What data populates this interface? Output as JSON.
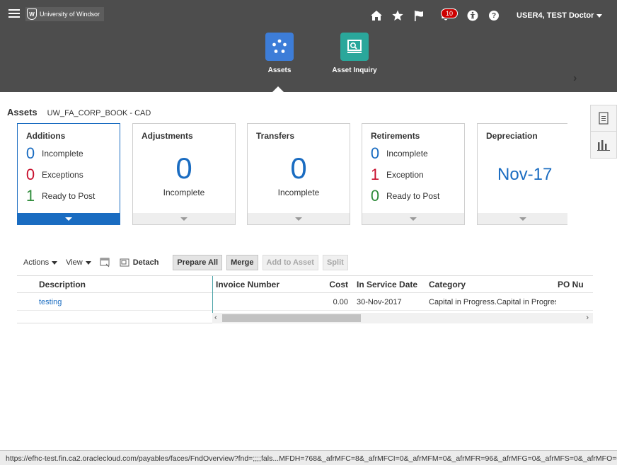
{
  "header": {
    "logo_text": "University of Windsor",
    "notification_count": "10",
    "user_name": "USER4, TEST Doctor"
  },
  "icons": {
    "menu": "hamburger-icon",
    "home": "home-icon",
    "favorites": "star-icon",
    "watchlist": "flag-icon",
    "notifications": "bell-icon",
    "accessibility": "accessibility-icon",
    "help": "help-icon"
  },
  "apps": [
    {
      "label": "Assets",
      "color": "#3d7dd8",
      "icon": "assets-icon"
    },
    {
      "label": "Asset Inquiry",
      "color": "#2aa79b",
      "icon": "asset-inquiry-icon"
    }
  ],
  "page": {
    "title": "Assets",
    "book": "UW_FA_CORP_BOOK - CAD"
  },
  "cards": {
    "additions": {
      "title": "Additions",
      "rows": [
        {
          "value": "0",
          "label": "Incomplete",
          "color": "#1a6cc1"
        },
        {
          "value": "0",
          "label": "Exceptions",
          "color": "#c8102e"
        },
        {
          "value": "1",
          "label": "Ready to Post",
          "color": "#2e8b3a"
        }
      ]
    },
    "adjustments": {
      "title": "Adjustments",
      "value": "0",
      "label": "Incomplete"
    },
    "transfers": {
      "title": "Transfers",
      "value": "0",
      "label": "Incomplete"
    },
    "retirements": {
      "title": "Retirements",
      "rows": [
        {
          "value": "0",
          "label": "Incomplete",
          "color": "#1a6cc1"
        },
        {
          "value": "1",
          "label": "Exception",
          "color": "#c8102e"
        },
        {
          "value": "0",
          "label": "Ready to Post",
          "color": "#2e8b3a"
        }
      ]
    },
    "depreciation": {
      "title": "Depreciation",
      "value": "Nov-17"
    }
  },
  "toolbar": {
    "actions": "Actions",
    "view": "View",
    "detach": "Detach",
    "prepare_all": "Prepare All",
    "merge": "Merge",
    "add_to_asset": "Add to Asset",
    "split": "Split"
  },
  "table": {
    "headers": {
      "description": "Description",
      "invoice_number": "Invoice Number",
      "cost": "Cost",
      "in_service_date": "In Service Date",
      "category": "Category",
      "po_number": "PO Nu"
    },
    "rows": [
      {
        "description": "testing",
        "invoice_number": "",
        "cost": "0.00",
        "in_service_date": "30-Nov-2017",
        "category": "Capital in Progress.Capital in Progres",
        "po_number": ""
      }
    ]
  },
  "status_bar": {
    "url": "https://efhc-test.fin.ca2.oraclecloud.com/payables/faces/FndOverview?fnd=;;;;fals...MFDH=768&_afrMFC=8&_afrMFCI=0&_afrMFM=0&_afrMFR=96&_afrMFG=0&_afrMFS=0&_afrMFO=0#"
  }
}
